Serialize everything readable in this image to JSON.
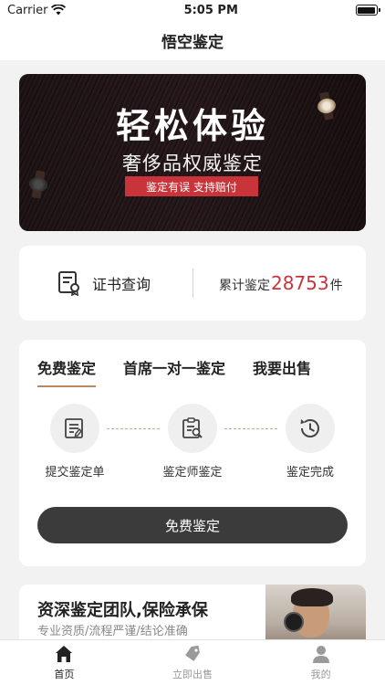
{
  "status": {
    "carrier": "Carrier",
    "time": "5:05 PM"
  },
  "nav": {
    "title": "悟空鉴定"
  },
  "banner": {
    "headline": "轻松体验",
    "subline": "奢侈品权威鉴定",
    "tag": "鉴定有误 支持赔付"
  },
  "query": {
    "cert_label": "证书查询",
    "count_prefix": "累计鉴定",
    "count_value": "28753",
    "count_suffix": "件"
  },
  "process": {
    "tabs": [
      {
        "label": "免费鉴定"
      },
      {
        "label": "首席一对一鉴定"
      },
      {
        "label": "我要出售"
      }
    ],
    "steps": [
      {
        "label": "提交鉴定单",
        "icon": "form-icon"
      },
      {
        "label": "鉴定师鉴定",
        "icon": "clipboard-search-icon"
      },
      {
        "label": "鉴定完成",
        "icon": "history-clock-icon"
      }
    ],
    "button": "免费鉴定"
  },
  "team": {
    "title": "资深鉴定团队,保险承保",
    "subtitle": "专业资质/流程严谨/结论准确"
  },
  "tabbar": [
    {
      "label": "首页",
      "icon": "home-icon",
      "active": true
    },
    {
      "label": "立即出售",
      "icon": "tag-icon",
      "active": false
    },
    {
      "label": "我的",
      "icon": "user-icon",
      "active": false
    }
  ],
  "colors": {
    "accent_red": "#c8343a",
    "tab_underline": "#b8895f",
    "button_dark": "#3b3b3b"
  }
}
